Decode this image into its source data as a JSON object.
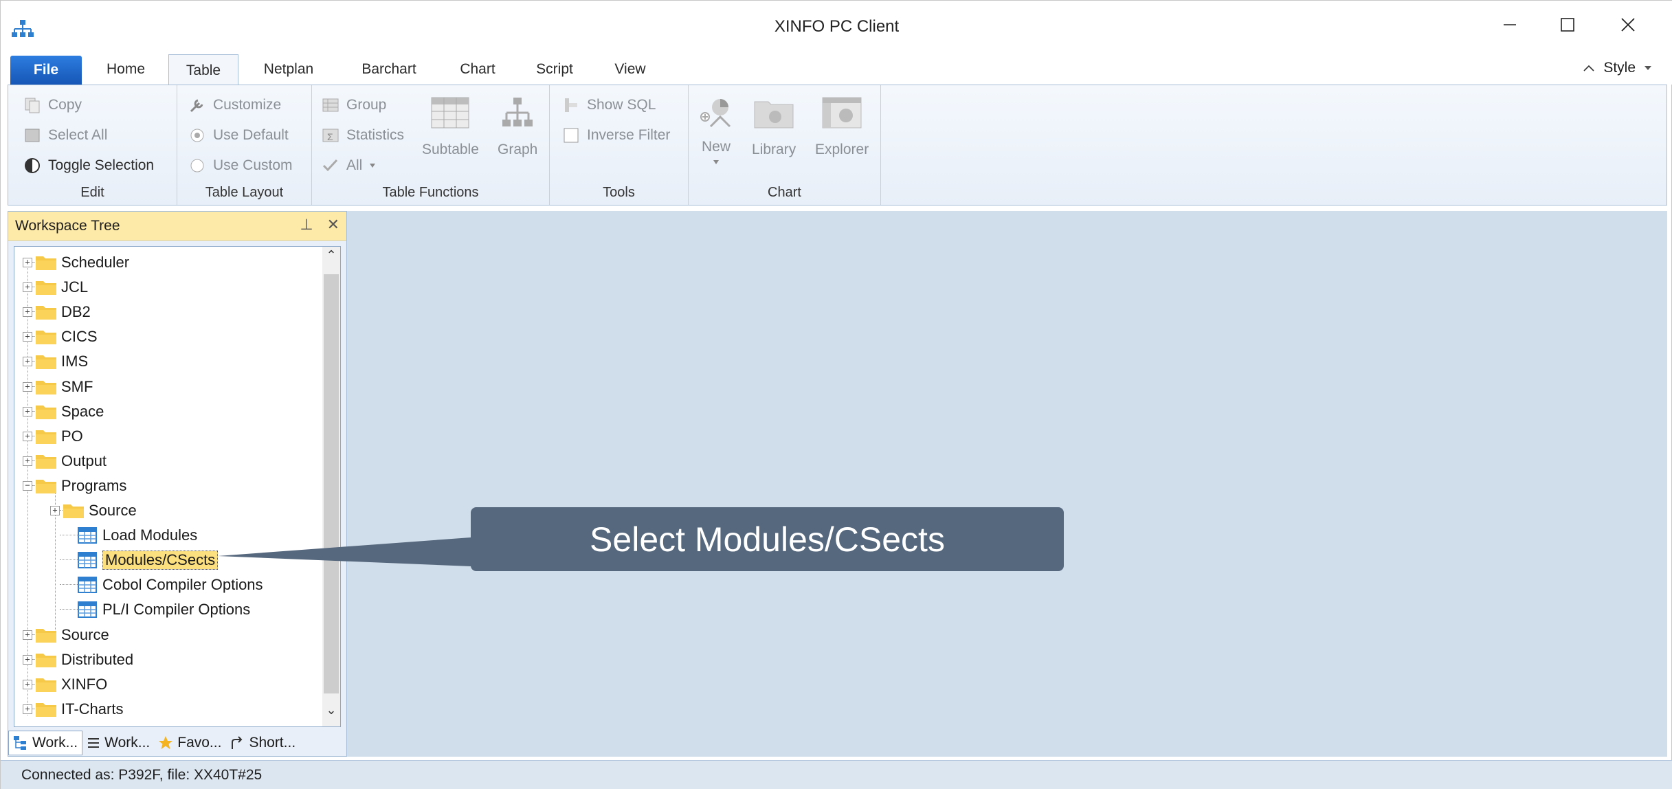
{
  "window": {
    "title": "XINFO PC Client"
  },
  "icons": {
    "app": "hierarchy-icon",
    "minimize": "minimize-icon",
    "maximize": "maximize-icon",
    "close": "close-icon",
    "pin": "pin-icon",
    "panel_close": "close-icon"
  },
  "tabs": [
    {
      "label": "File"
    },
    {
      "label": "Home"
    },
    {
      "label": "Table"
    },
    {
      "label": "Netplan"
    },
    {
      "label": "Barchart"
    },
    {
      "label": "Chart"
    },
    {
      "label": "Script"
    },
    {
      "label": "View"
    }
  ],
  "style_menu": {
    "label": "Style"
  },
  "ribbon": {
    "edit": {
      "label": "Edit",
      "copy": "Copy",
      "select_all": "Select All",
      "toggle": "Toggle Selection"
    },
    "layout": {
      "label": "Table Layout",
      "customize": "Customize",
      "use_default": "Use Default",
      "use_custom": "Use Custom"
    },
    "functions": {
      "label": "Table Functions",
      "group": "Group",
      "statistics": "Statistics",
      "all": "All",
      "subtable": "Subtable",
      "graph": "Graph"
    },
    "tools": {
      "label": "Tools",
      "show_sql": "Show SQL",
      "inverse_filter": "Inverse Filter"
    },
    "chart": {
      "label": "Chart",
      "new": "New",
      "library": "Library",
      "explorer": "Explorer"
    }
  },
  "panel": {
    "title": "Workspace Tree",
    "tree": [
      "Scheduler",
      "JCL",
      "DB2",
      "CICS",
      "IMS",
      "SMF",
      "Space",
      "PO",
      "Output",
      "Programs",
      "Source",
      "Load Modules",
      "Modules/CSects",
      "Cobol Compiler Options",
      "PL/I Compiler Options",
      "Source",
      "Distributed",
      "XINFO",
      "IT-Charts"
    ],
    "bottom_tabs": [
      "Work...",
      "Work...",
      "Favo...",
      "Short..."
    ]
  },
  "callout": {
    "text": "Select Modules/CSects"
  },
  "status": {
    "text": "Connected as: P392F, file: XX40T#25"
  },
  "colors": {
    "accent": "#1656b6",
    "callout": "#56687d",
    "panel_header": "#fde9a8",
    "workspace": "#d0ddeb",
    "folder": "#f7c948"
  }
}
